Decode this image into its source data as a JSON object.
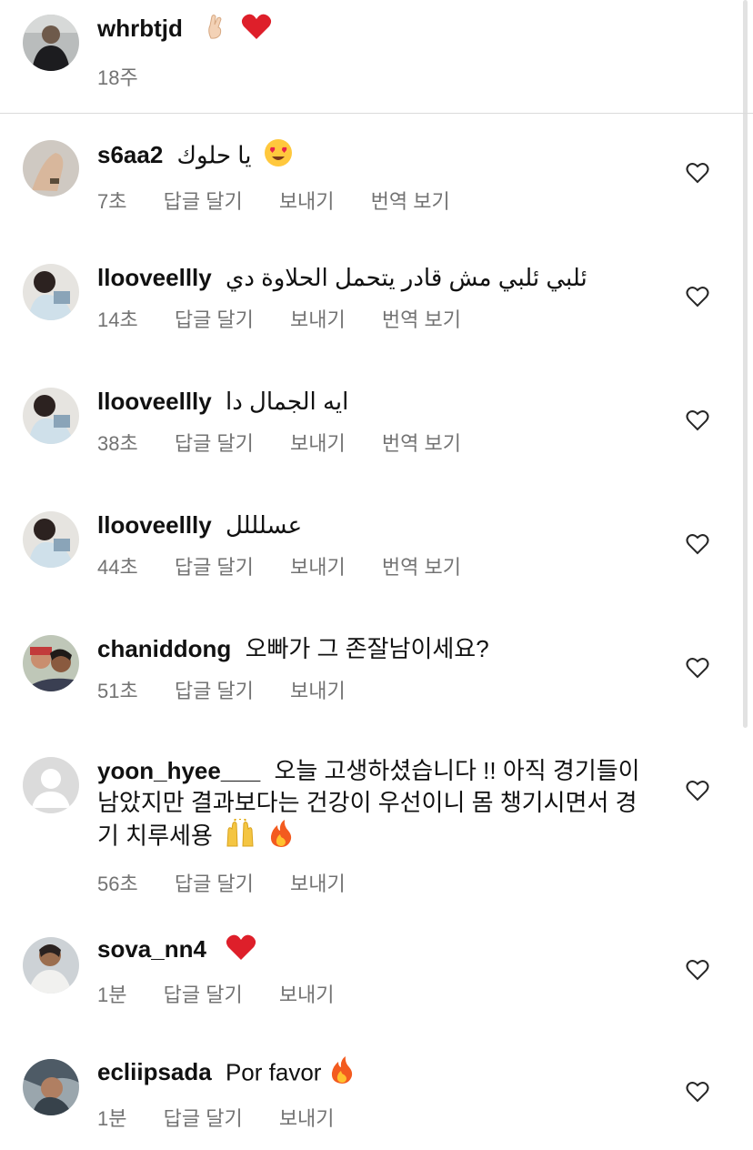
{
  "caption": {
    "username": "whrbtjd",
    "time": "18주"
  },
  "actions": {
    "reply": "답글 달기",
    "send": "보내기",
    "translate": "번역 보기"
  },
  "comments": [
    {
      "username": "s6aa2",
      "text": "يا حلوك",
      "time": "7초",
      "has_translate": true,
      "emoji": "heart-eyes"
    },
    {
      "username": "llooveellly",
      "text": "ئلبي ئلبي مش قادر يتحمل الحلاوة دي",
      "time": "14초",
      "has_translate": true
    },
    {
      "username": "llooveellly",
      "text": "ايه الجمال دا",
      "time": "38초",
      "has_translate": true
    },
    {
      "username": "llooveellly",
      "text": "عسلللل",
      "time": "44초",
      "has_translate": true
    },
    {
      "username": "chaniddong",
      "text": "오빠가 그 존잘남이세요?",
      "time": "51초",
      "has_translate": false
    },
    {
      "username": "yoon_hyee___",
      "text": "오늘 고생하셨습니다 !! 아직 경기들이 남았지만 결과보다는 건강이 우선이니 몸 챙기시면서 경기 치루세용",
      "time": "56초",
      "has_translate": false,
      "emoji": "raising-hands, fire"
    },
    {
      "username": "sova_nn4",
      "text": "",
      "time": "1분",
      "has_translate": false,
      "emoji": "red-heart"
    },
    {
      "username": "ecliipsada",
      "text": "Por favor",
      "time": "1분",
      "has_translate": false,
      "emoji": "fire"
    }
  ],
  "colors": {
    "meta": "#737373",
    "text": "#111111",
    "divider": "#dbdbdb"
  }
}
